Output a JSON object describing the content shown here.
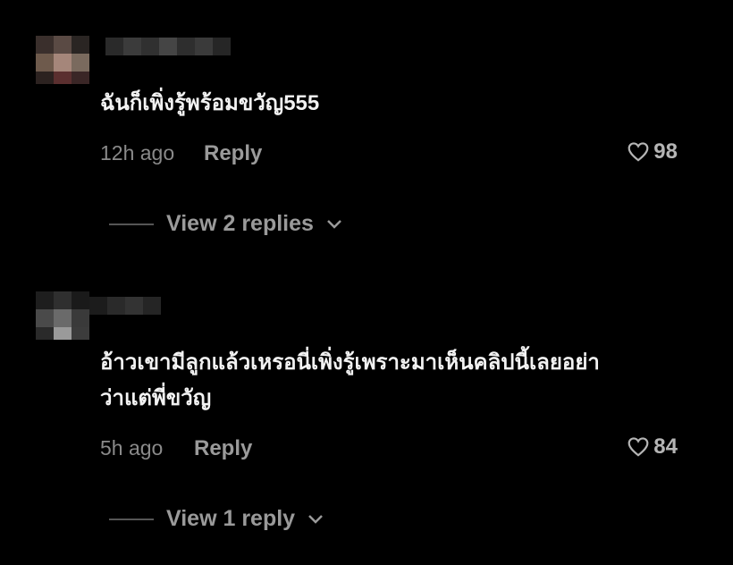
{
  "comments": [
    {
      "text": "ฉันก็เพิ่งรู้พร้อมขวัญ555",
      "time": "12h ago",
      "reply_label": "Reply",
      "likes": "98",
      "view_replies_label": "View 2 replies"
    },
    {
      "text_line1": "อ้าวเขามีลูกแล้วเหรอนี่เพิ่งรู้เพราะมาเห็นคลิปนี้เลยอย่า",
      "text_line2": "ว่าแต่พี่ขวัญ",
      "time": "5h ago",
      "reply_label": "Reply",
      "likes": "84",
      "view_replies_label": "View 1 reply"
    }
  ],
  "icons": {
    "like": "heart-outline-icon",
    "expand": "chevron-down-icon"
  },
  "colors": {
    "background": "#000000",
    "text": "#f2f2f2",
    "muted": "#8a8a8a"
  }
}
